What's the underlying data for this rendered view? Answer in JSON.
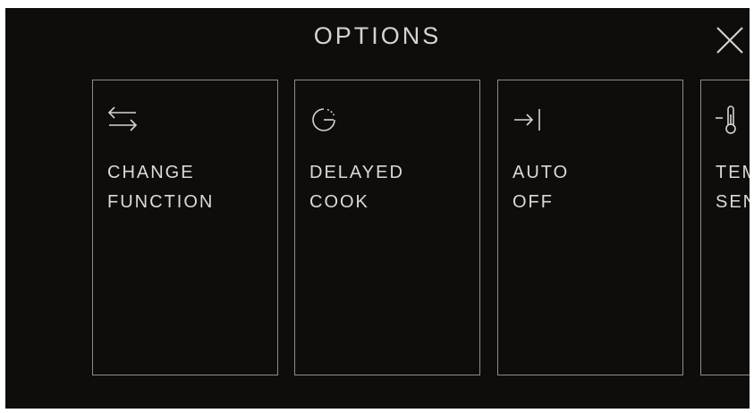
{
  "header": {
    "title": "OPTIONS",
    "close_icon": "close-icon"
  },
  "options": [
    {
      "icon": "swap-arrows-icon",
      "line1": "CHANGE",
      "line2": "FUNCTION"
    },
    {
      "icon": "timer-icon",
      "line1": "DELAYED",
      "line2": "COOK"
    },
    {
      "icon": "arrow-to-bar-icon",
      "line1": "AUTO",
      "line2": "OFF"
    },
    {
      "icon": "thermometer-icon",
      "line1": "TEMP",
      "line2": "SENSOR"
    }
  ],
  "colors": {
    "background": "#0f0d0c",
    "text": "#d8d6d3",
    "card_border": "#8e8b87"
  }
}
